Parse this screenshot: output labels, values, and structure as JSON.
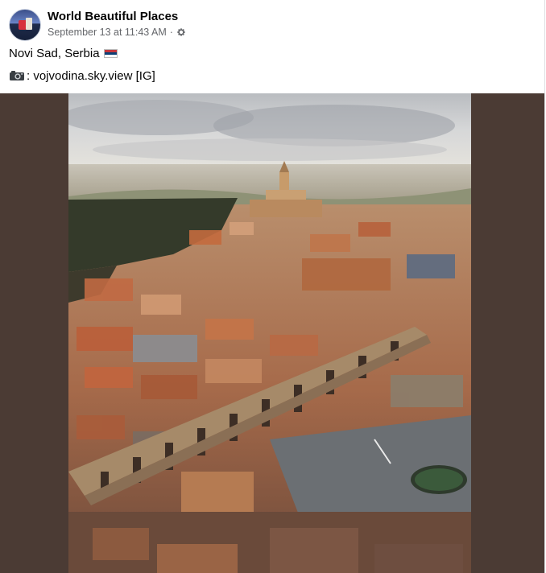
{
  "post": {
    "page_name": "World Beautiful Places",
    "timestamp": "September 13 at 11:43 AM",
    "separator": "·",
    "audience_icon": "gear-icon",
    "location_text": "Novi Sad, Serbia",
    "flag_icon": "serbia-flag-icon",
    "camera_icon": "camera-icon",
    "credit_text": ": vojvodina.sky.view [IG]"
  },
  "colors": {
    "name_text": "#050505",
    "meta_text": "#65676b",
    "photo_backdrop": "#4b3b34"
  }
}
